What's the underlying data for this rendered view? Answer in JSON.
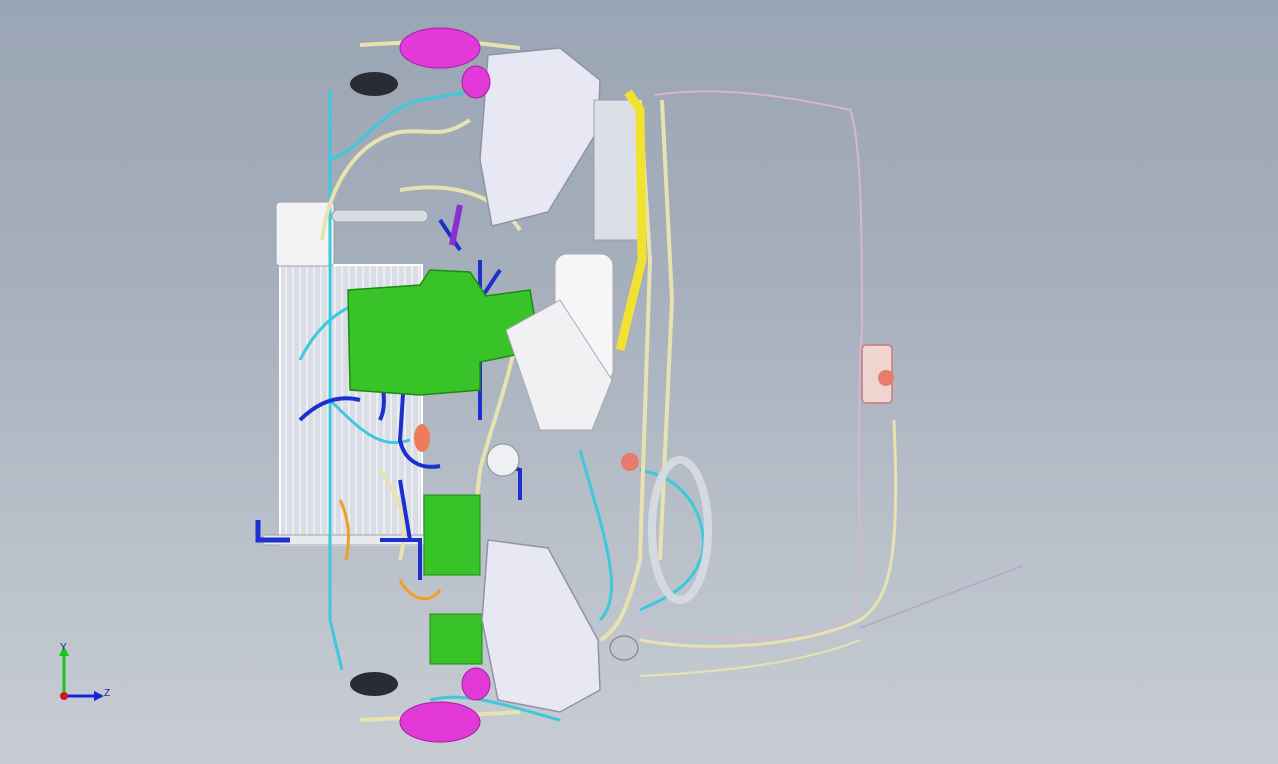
{
  "viewport": {
    "background_top": "#9aa5b5",
    "background_bottom": "#c8cdd3"
  },
  "colors": {
    "harness_cyan": "#3ec8dc",
    "harness_blue": "#1d2fd0",
    "harness_cream": "#e8e2b0",
    "green_module": "#38c428",
    "magenta_part": "#e23ad8",
    "yellow_rail": "#f2e230",
    "white_part": "#f2f2f4",
    "grey_part": "#c9ccd6",
    "orange_hose": "#f0a020",
    "purple_hose": "#8a2fd2"
  },
  "triad": {
    "y_label": "Y",
    "z_label": "Z",
    "y_color": "#19c419",
    "z_color": "#1a22d8",
    "x_color": "#d01818"
  }
}
